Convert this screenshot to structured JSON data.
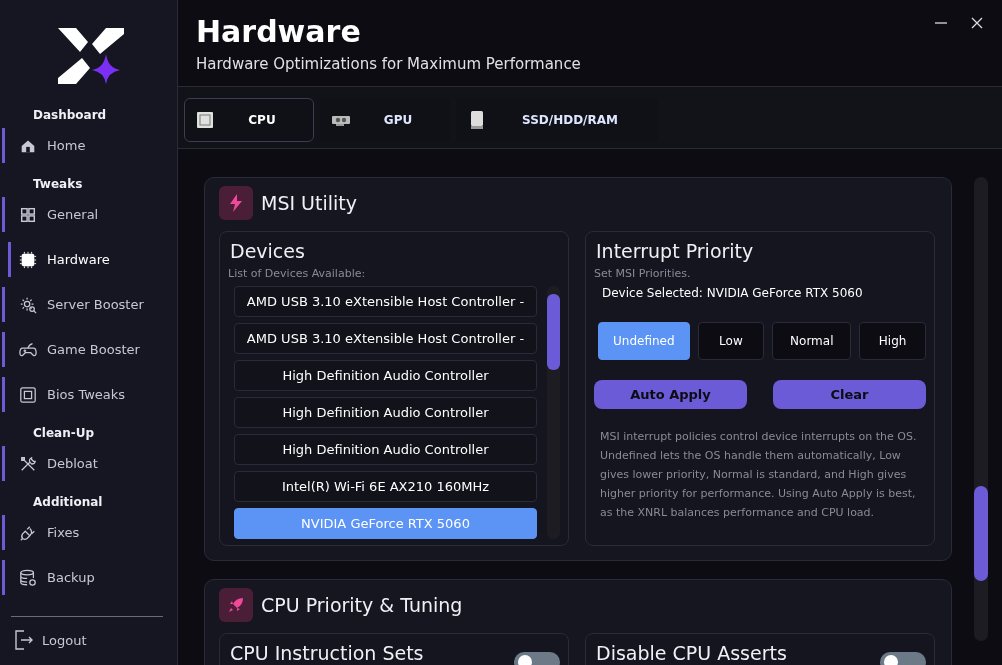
{
  "sidebar": {
    "sections": [
      {
        "label": "Dashboard",
        "items": [
          {
            "label": "Home",
            "selected": false
          }
        ]
      },
      {
        "label": "Tweaks",
        "items": [
          {
            "label": "General",
            "selected": false
          },
          {
            "label": "Hardware",
            "selected": true
          },
          {
            "label": "Server Booster",
            "selected": false
          },
          {
            "label": "Game Booster",
            "selected": false
          },
          {
            "label": "Bios Tweaks",
            "selected": false
          }
        ]
      },
      {
        "label": "Clean-Up",
        "items": [
          {
            "label": "Debloat",
            "selected": false
          }
        ]
      },
      {
        "label": "Additional",
        "items": [
          {
            "label": "Fixes",
            "selected": false
          },
          {
            "label": "Backup",
            "selected": false
          }
        ]
      }
    ],
    "logout": "Logout"
  },
  "header": {
    "title": "Hardware",
    "subtitle": "Hardware Optimizations for Maximum Performance"
  },
  "tabs": [
    {
      "label": "CPU",
      "selected": true
    },
    {
      "label": "GPU",
      "selected": false
    },
    {
      "label": "SSD/HDD/RAM",
      "selected": false
    }
  ],
  "msi_utility": {
    "title": "MSI Utility",
    "devices": {
      "title": "Devices",
      "subtitle": "List of Devices Available:",
      "items": [
        {
          "label": "AMD USB 3.10 eXtensible Host Controller -",
          "selected": false
        },
        {
          "label": "AMD USB 3.10 eXtensible Host Controller -",
          "selected": false
        },
        {
          "label": "High Definition Audio Controller",
          "selected": false
        },
        {
          "label": "High Definition Audio Controller",
          "selected": false
        },
        {
          "label": "High Definition Audio Controller",
          "selected": false
        },
        {
          "label": "Intel(R) Wi-Fi 6E AX210 160MHz",
          "selected": false
        },
        {
          "label": "NVIDIA GeForce RTX 5060",
          "selected": true
        }
      ]
    },
    "interrupt": {
      "title": "Interrupt Priority",
      "subtitle": "Set MSI Priorities.",
      "device_selected": "Device Selected: NVIDIA GeForce RTX 5060",
      "priorities": [
        {
          "label": "Undefined",
          "selected": true
        },
        {
          "label": "Low",
          "selected": false
        },
        {
          "label": "Normal",
          "selected": false
        },
        {
          "label": "High",
          "selected": false
        }
      ],
      "buttons": [
        "Auto Apply",
        "Clear"
      ],
      "description": "MSI interrupt policies control device interrupts on the OS. Undefined lets the OS handle them automatically, Low gives lower priority, Normal is standard, and High gives higher priority for performance. Using Auto Apply is best, as the XNRL balances performance and CPU load."
    }
  },
  "cpu_priority": {
    "title": "CPU Priority & Tuning",
    "options": [
      {
        "label": "CPU Instruction Sets",
        "on": false
      },
      {
        "label": "Disable CPU Asserts",
        "on": false
      }
    ]
  }
}
